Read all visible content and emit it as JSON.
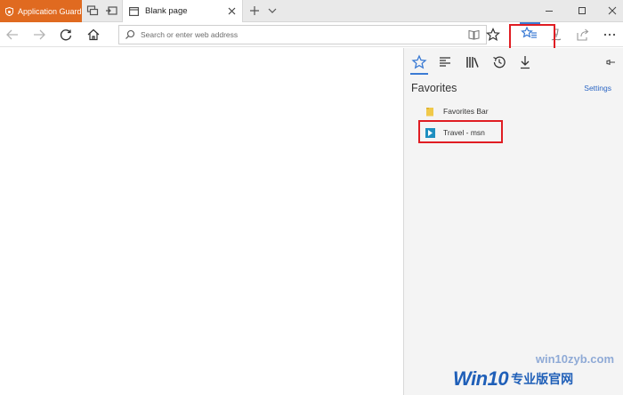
{
  "titlebar": {
    "guard_tab_label": "Application Guard",
    "active_tab_label": "Blank page"
  },
  "navbar": {
    "address_placeholder": "Search or enter web address"
  },
  "hub": {
    "title": "Favorites",
    "settings_label": "Settings",
    "items": [
      {
        "label": "Favorites Bar",
        "icon": "folder-icon"
      },
      {
        "label": "Travel - msn",
        "icon": "msn-travel-icon"
      }
    ]
  },
  "watermark": {
    "url": "win10zyb.com",
    "logo_main": "Win10",
    "logo_sub": "专业版官网"
  },
  "colors": {
    "guard_orange": "#e06a20",
    "highlight_red": "#e01d23",
    "accent_blue": "#3b7bd4",
    "link_blue": "#2b66c4",
    "folder_yellow": "#f0c94a"
  }
}
